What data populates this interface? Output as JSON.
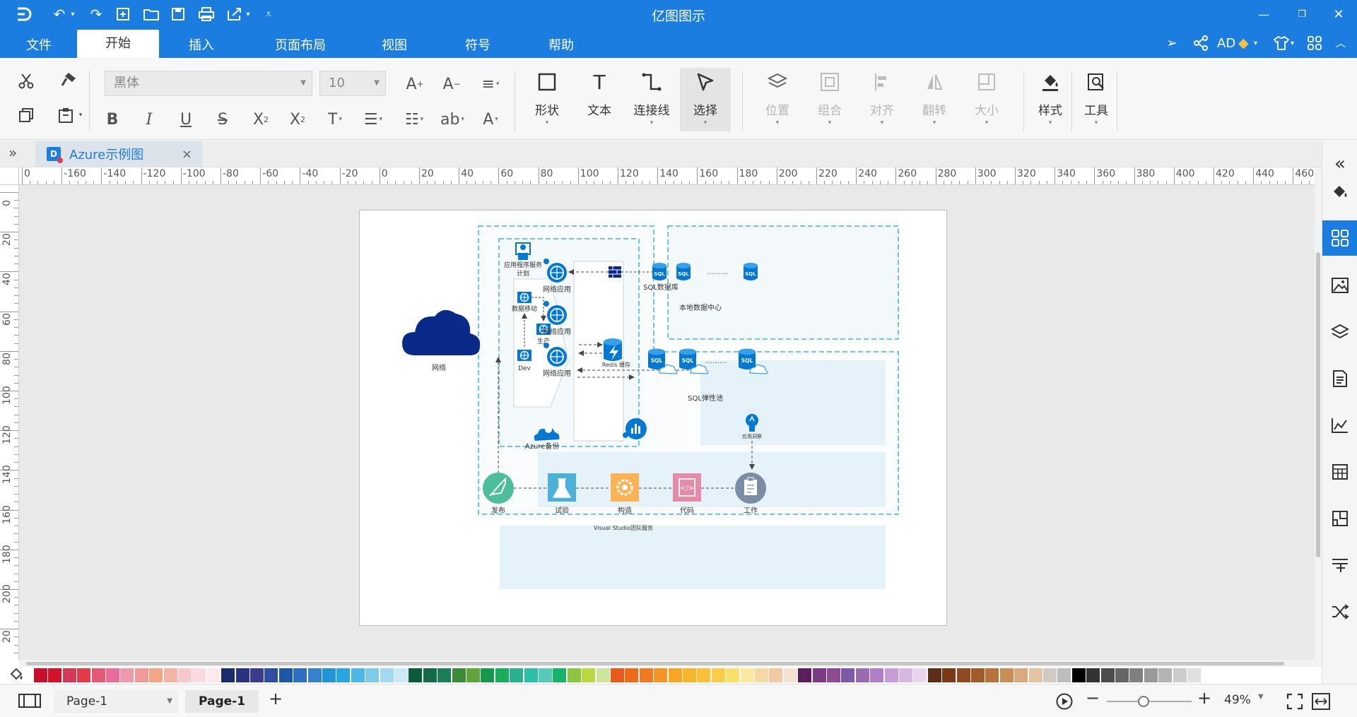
{
  "app": {
    "title": "亿图图示"
  },
  "menu": {
    "tabs": [
      "文件",
      "开始",
      "插入",
      "页面布局",
      "视图",
      "符号",
      "帮助"
    ],
    "active": "开始",
    "user": "AD"
  },
  "ribbon": {
    "font_name": "黑体",
    "font_size": "10",
    "big_buttons": {
      "shape": "形状",
      "text": "文本",
      "connector": "连接线",
      "select": "选择",
      "position": "位置",
      "group": "组合",
      "align": "对齐",
      "flip": "翻转",
      "size": "大小",
      "style": "样式",
      "tools": "工具"
    }
  },
  "document": {
    "tab_name": "Azure示例图",
    "close_glyph": "×"
  },
  "ruler": {
    "h_labels": [
      "0",
      "-160",
      "-140",
      "-120",
      "-100",
      "-80",
      "-60",
      "-40",
      "-20",
      "0",
      "20",
      "40",
      "60",
      "80",
      "100",
      "120",
      "140",
      "160",
      "180",
      "200",
      "220",
      "240",
      "260",
      "280",
      "300",
      "320",
      "340",
      "360",
      "380",
      "400",
      "420",
      "440",
      "460"
    ],
    "v_labels": [
      "0",
      "20",
      "40",
      "60",
      "80",
      "100",
      "120",
      "140",
      "160",
      "180",
      "200",
      "20"
    ]
  },
  "diagram": {
    "network": "网络",
    "plan_line1": "应用程序服务",
    "plan_line2": "计划",
    "data_migration": "数据移动",
    "production": "生产",
    "dev": "Dev",
    "web_app": "网络应用",
    "sql_db": "SQL数据库",
    "dots": "………",
    "onprem": "本地数据中心",
    "redis": "Redis 缓存",
    "sql_pool": "SQL弹性池",
    "azure_backup": "Azure备份",
    "app_insights": "应用洞察",
    "sql_label": "SQL",
    "publish": "发布",
    "test": "试验",
    "build": "构造",
    "code": "代码",
    "work": "工作",
    "vs_team": "Visual Studio团队服务"
  },
  "palette": [
    "#c8102e",
    "#d0142a",
    "#d13b55",
    "#e23c4a",
    "#e55a72",
    "#e96d9b",
    "#ec9aa9",
    "#f09999",
    "#f4a586",
    "#f4b4a6",
    "#f6c8c8",
    "#f9d9e2",
    "#fde8ee",
    "#1c2d6b",
    "#26357d",
    "#3a3c8c",
    "#2f4ea0",
    "#1d58a8",
    "#2b6fc0",
    "#3481d0",
    "#1f94d6",
    "#2aa6df",
    "#4db8e6",
    "#7ccbea",
    "#a3d9ee",
    "#cde9f5",
    "#0c5b3c",
    "#126c48",
    "#1a8058",
    "#3b8b3b",
    "#5ea639",
    "#149a4a",
    "#19ad5e",
    "#28b18c",
    "#2bbfa4",
    "#57c9b7",
    "#18b36a",
    "#8cc63f",
    "#b8d940",
    "#cde59a",
    "#e85a19",
    "#ec6c1c",
    "#f07a23",
    "#f39425",
    "#f6a623",
    "#f8b62b",
    "#fac03a",
    "#fccb48",
    "#fde06a",
    "#fbe9a0",
    "#f4d9a0",
    "#f2c9a3",
    "#f5e4cf",
    "#5b1f5e",
    "#7b3a84",
    "#8f4b8f",
    "#7b5aa6",
    "#9a6bb0",
    "#b07dc6",
    "#c69dd5",
    "#d7b8e2",
    "#e8d6ef",
    "#5e2e16",
    "#7b3a16",
    "#8f4a1f",
    "#a35b2a",
    "#b7713a",
    "#c98d56",
    "#d8aa7d",
    "#e3c5a4",
    "#cfcac3",
    "#bdbdbd",
    "#000000",
    "#333333",
    "#4d4d4d",
    "#666666",
    "#808080",
    "#999999",
    "#b3b3b3",
    "#cccccc",
    "#e0e0e0"
  ],
  "status": {
    "page_select": "Page-1",
    "page_tab": "Page-1",
    "zoom": "49%"
  },
  "colors": {
    "accent": "#1c7de0",
    "azure": "#0078d4",
    "navy": "#0a2a8a"
  }
}
